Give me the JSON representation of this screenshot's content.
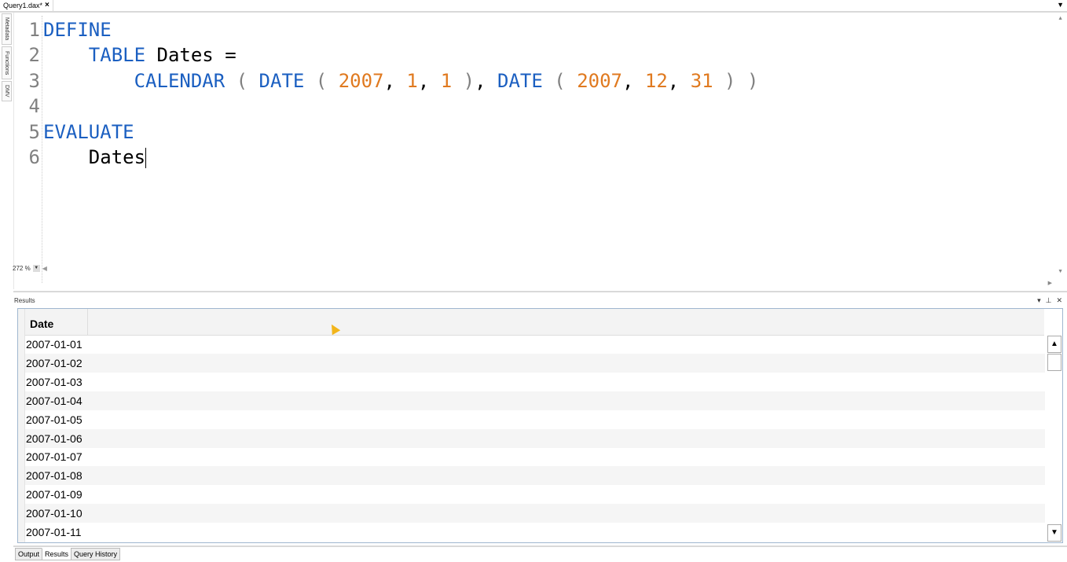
{
  "tabs": [
    {
      "label": "Query1.dax*",
      "close_icon": "×"
    }
  ],
  "side_tabs": [
    "Metadata",
    "Functions",
    "DMV"
  ],
  "editor": {
    "lines": [
      {
        "num": "1",
        "tokens": [
          {
            "t": "DEFINE",
            "c": "kw"
          }
        ]
      },
      {
        "num": "2",
        "tokens": [
          {
            "t": "    ",
            "c": "plain"
          },
          {
            "t": "TABLE",
            "c": "kw"
          },
          {
            "t": " Dates =",
            "c": "plain"
          }
        ]
      },
      {
        "num": "3",
        "tokens": [
          {
            "t": "        ",
            "c": "plain"
          },
          {
            "t": "CALENDAR",
            "c": "kw"
          },
          {
            "t": " ( ",
            "c": "paren"
          },
          {
            "t": "DATE",
            "c": "kw"
          },
          {
            "t": " ( ",
            "c": "paren"
          },
          {
            "t": "2007",
            "c": "num"
          },
          {
            "t": ", ",
            "c": "plain"
          },
          {
            "t": "1",
            "c": "num"
          },
          {
            "t": ", ",
            "c": "plain"
          },
          {
            "t": "1",
            "c": "num"
          },
          {
            "t": " )",
            "c": "paren"
          },
          {
            "t": ", ",
            "c": "plain"
          },
          {
            "t": "DATE",
            "c": "kw"
          },
          {
            "t": " ( ",
            "c": "paren"
          },
          {
            "t": "2007",
            "c": "num"
          },
          {
            "t": ", ",
            "c": "plain"
          },
          {
            "t": "12",
            "c": "num"
          },
          {
            "t": ", ",
            "c": "plain"
          },
          {
            "t": "31",
            "c": "num"
          },
          {
            "t": " ) )",
            "c": "paren"
          }
        ]
      },
      {
        "num": "4",
        "tokens": []
      },
      {
        "num": "5",
        "tokens": [
          {
            "t": "EVALUATE",
            "c": "kw"
          }
        ]
      },
      {
        "num": "6",
        "tokens": [
          {
            "t": "    Dates",
            "c": "plain"
          }
        ]
      }
    ],
    "zoom_level": "272 %"
  },
  "results": {
    "title": "Results",
    "columns": [
      "Date"
    ],
    "rows": [
      "2007-01-01",
      "2007-01-02",
      "2007-01-03",
      "2007-01-04",
      "2007-01-05",
      "2007-01-06",
      "2007-01-07",
      "2007-01-08",
      "2007-01-09",
      "2007-01-10",
      "2007-01-11"
    ]
  },
  "bottom_tabs": [
    {
      "label": "Output",
      "active": false
    },
    {
      "label": "Results",
      "active": true
    },
    {
      "label": "Query History",
      "active": false
    }
  ]
}
